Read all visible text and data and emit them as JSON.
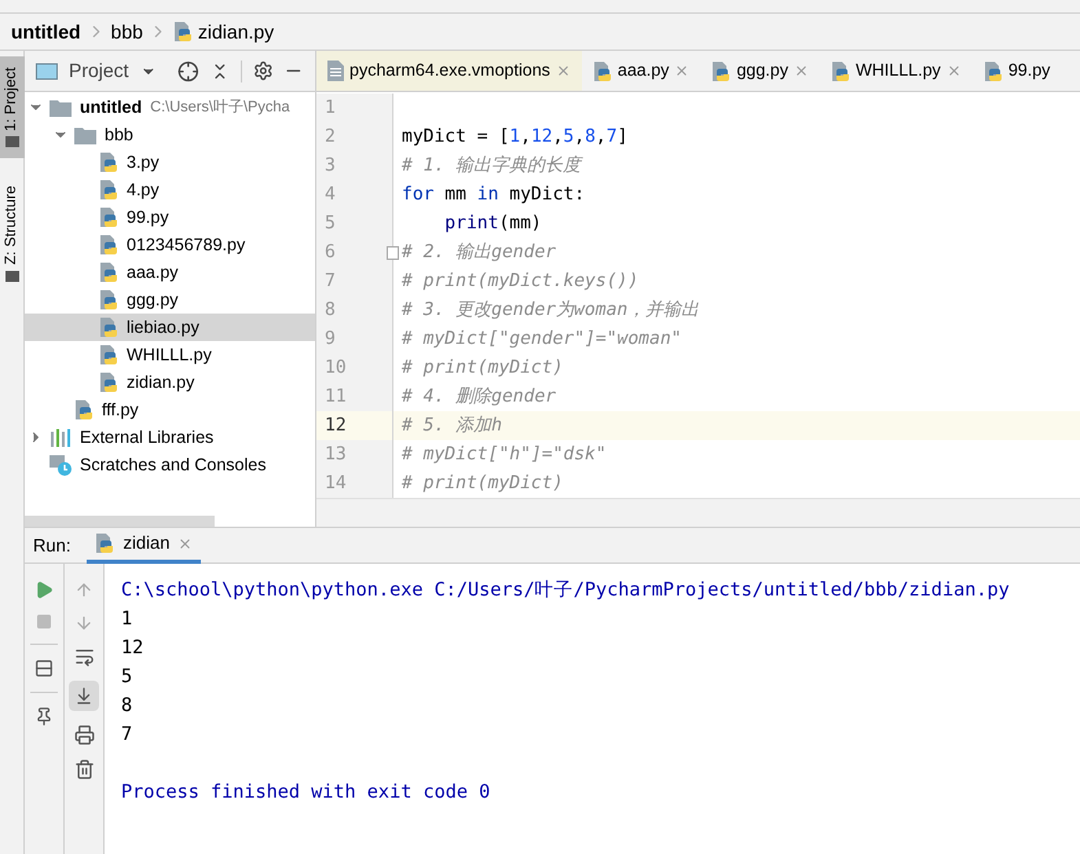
{
  "breadcrumb": [
    {
      "label": "untitled",
      "kind": "root"
    },
    {
      "label": "bbb",
      "kind": "folder"
    },
    {
      "label": "zidian.py",
      "kind": "python"
    }
  ],
  "tool_strip": [
    {
      "label": "1: Project",
      "selected": true
    },
    {
      "label": "Z: Structure",
      "selected": false
    }
  ],
  "project_panel": {
    "title": "Project",
    "tree": [
      {
        "label": "untitled",
        "kind": "folder",
        "expanded": true,
        "selected": false,
        "path": "C:\\Users\\叶子\\Pycha",
        "children": [
          {
            "label": "bbb",
            "kind": "folder",
            "expanded": true,
            "selected": false,
            "children": [
              {
                "label": "3.py",
                "kind": "python",
                "selected": false
              },
              {
                "label": "4.py",
                "kind": "python",
                "selected": false
              },
              {
                "label": "99.py",
                "kind": "python",
                "selected": false
              },
              {
                "label": "0123456789.py",
                "kind": "python",
                "selected": false
              },
              {
                "label": "aaa.py",
                "kind": "python",
                "selected": false
              },
              {
                "label": "ggg.py",
                "kind": "python",
                "selected": false
              },
              {
                "label": "liebiao.py",
                "kind": "python",
                "selected": true
              },
              {
                "label": "WHILLL.py",
                "kind": "python",
                "selected": false
              },
              {
                "label": "zidian.py",
                "kind": "python",
                "selected": false
              }
            ]
          },
          {
            "label": "fff.py",
            "kind": "python",
            "selected": false
          }
        ]
      },
      {
        "label": "External Libraries",
        "kind": "libraries",
        "expanded": false,
        "selected": false
      },
      {
        "label": "Scratches and Consoles",
        "kind": "scratches",
        "selected": false
      }
    ]
  },
  "editor_tabs": [
    {
      "label": "pycharm64.exe.vmoptions",
      "kind": "text",
      "selected": true,
      "closable": true
    },
    {
      "label": "aaa.py",
      "kind": "python",
      "selected": false,
      "closable": true
    },
    {
      "label": "ggg.py",
      "kind": "python",
      "selected": false,
      "closable": true
    },
    {
      "label": "WHILLL.py",
      "kind": "python",
      "selected": false,
      "closable": true
    },
    {
      "label": "99.py",
      "kind": "python",
      "selected": false,
      "closable": false
    }
  ],
  "code_lines": [
    {
      "number": "1",
      "current": false,
      "fold": false
    },
    {
      "number": "2",
      "current": false,
      "fold": false,
      "tokens": [
        {
          "text": "myDict = [",
          "kind": "plain"
        },
        {
          "text": "1",
          "kind": "number"
        },
        {
          "text": ",",
          "kind": "plain"
        },
        {
          "text": "12",
          "kind": "number"
        },
        {
          "text": ",",
          "kind": "plain"
        },
        {
          "text": "5",
          "kind": "number"
        },
        {
          "text": ",",
          "kind": "plain"
        },
        {
          "text": "8",
          "kind": "number"
        },
        {
          "text": ",",
          "kind": "plain"
        },
        {
          "text": "7",
          "kind": "number"
        },
        {
          "text": "]",
          "kind": "plain"
        }
      ]
    },
    {
      "number": "3",
      "current": false,
      "fold": false,
      "tokens": [
        {
          "text": "# 1. 输出字典的长度",
          "kind": "comment"
        }
      ]
    },
    {
      "number": "4",
      "current": false,
      "fold": false,
      "tokens": [
        {
          "text": "for",
          "kind": "keyword"
        },
        {
          "text": " mm ",
          "kind": "plain"
        },
        {
          "text": "in",
          "kind": "keyword"
        },
        {
          "text": " myDict:",
          "kind": "plain"
        }
      ]
    },
    {
      "number": "5",
      "current": false,
      "fold": false,
      "tokens": [
        {
          "text": "    print",
          "kind": "builtin"
        },
        {
          "text": "(mm)",
          "kind": "plain"
        }
      ]
    },
    {
      "number": "6",
      "current": false,
      "fold": true,
      "tokens": [
        {
          "text": "# 2. 输出gender",
          "kind": "comment"
        }
      ]
    },
    {
      "number": "7",
      "current": false,
      "fold": false,
      "tokens": [
        {
          "text": "# print(myDict.keys())",
          "kind": "comment"
        }
      ]
    },
    {
      "number": "8",
      "current": false,
      "fold": false,
      "tokens": [
        {
          "text": "# 3. 更改gender为woman，并输出",
          "kind": "comment"
        }
      ]
    },
    {
      "number": "9",
      "current": false,
      "fold": false,
      "tokens": [
        {
          "text": "# myDict[\"gender\"]=\"woman\"",
          "kind": "comment"
        }
      ]
    },
    {
      "number": "10",
      "current": false,
      "fold": false,
      "tokens": [
        {
          "text": "# print(myDict)",
          "kind": "comment"
        }
      ]
    },
    {
      "number": "11",
      "current": false,
      "fold": false,
      "tokens": [
        {
          "text": "# 4. 删除gender",
          "kind": "comment"
        }
      ]
    },
    {
      "number": "12",
      "current": true,
      "fold": false,
      "tokens": [
        {
          "text": "# 5. 添加h",
          "kind": "comment"
        }
      ]
    },
    {
      "number": "13",
      "current": false,
      "fold": false,
      "tokens": [
        {
          "text": "# myDict[\"h\"]=\"dsk\"",
          "kind": "comment"
        }
      ]
    },
    {
      "number": "14",
      "current": false,
      "fold": false,
      "tokens": [
        {
          "text": "# print(myDict)",
          "kind": "comment"
        }
      ]
    }
  ],
  "run_panel": {
    "label": "Run:",
    "tab": {
      "label": "zidian",
      "selected": true
    },
    "output": [
      {
        "text": "C:\\school\\python\\python.exe C:/Users/叶子/PycharmProjects/untitled/bbb/zidian.py",
        "kind": "system"
      },
      {
        "text": "1",
        "kind": "stdout"
      },
      {
        "text": "12",
        "kind": "stdout"
      },
      {
        "text": "5",
        "kind": "stdout"
      },
      {
        "text": "8",
        "kind": "stdout"
      },
      {
        "text": "7",
        "kind": "stdout"
      },
      {
        "kind": "blank"
      },
      {
        "text": "Process finished with exit code 0",
        "kind": "system"
      }
    ]
  }
}
